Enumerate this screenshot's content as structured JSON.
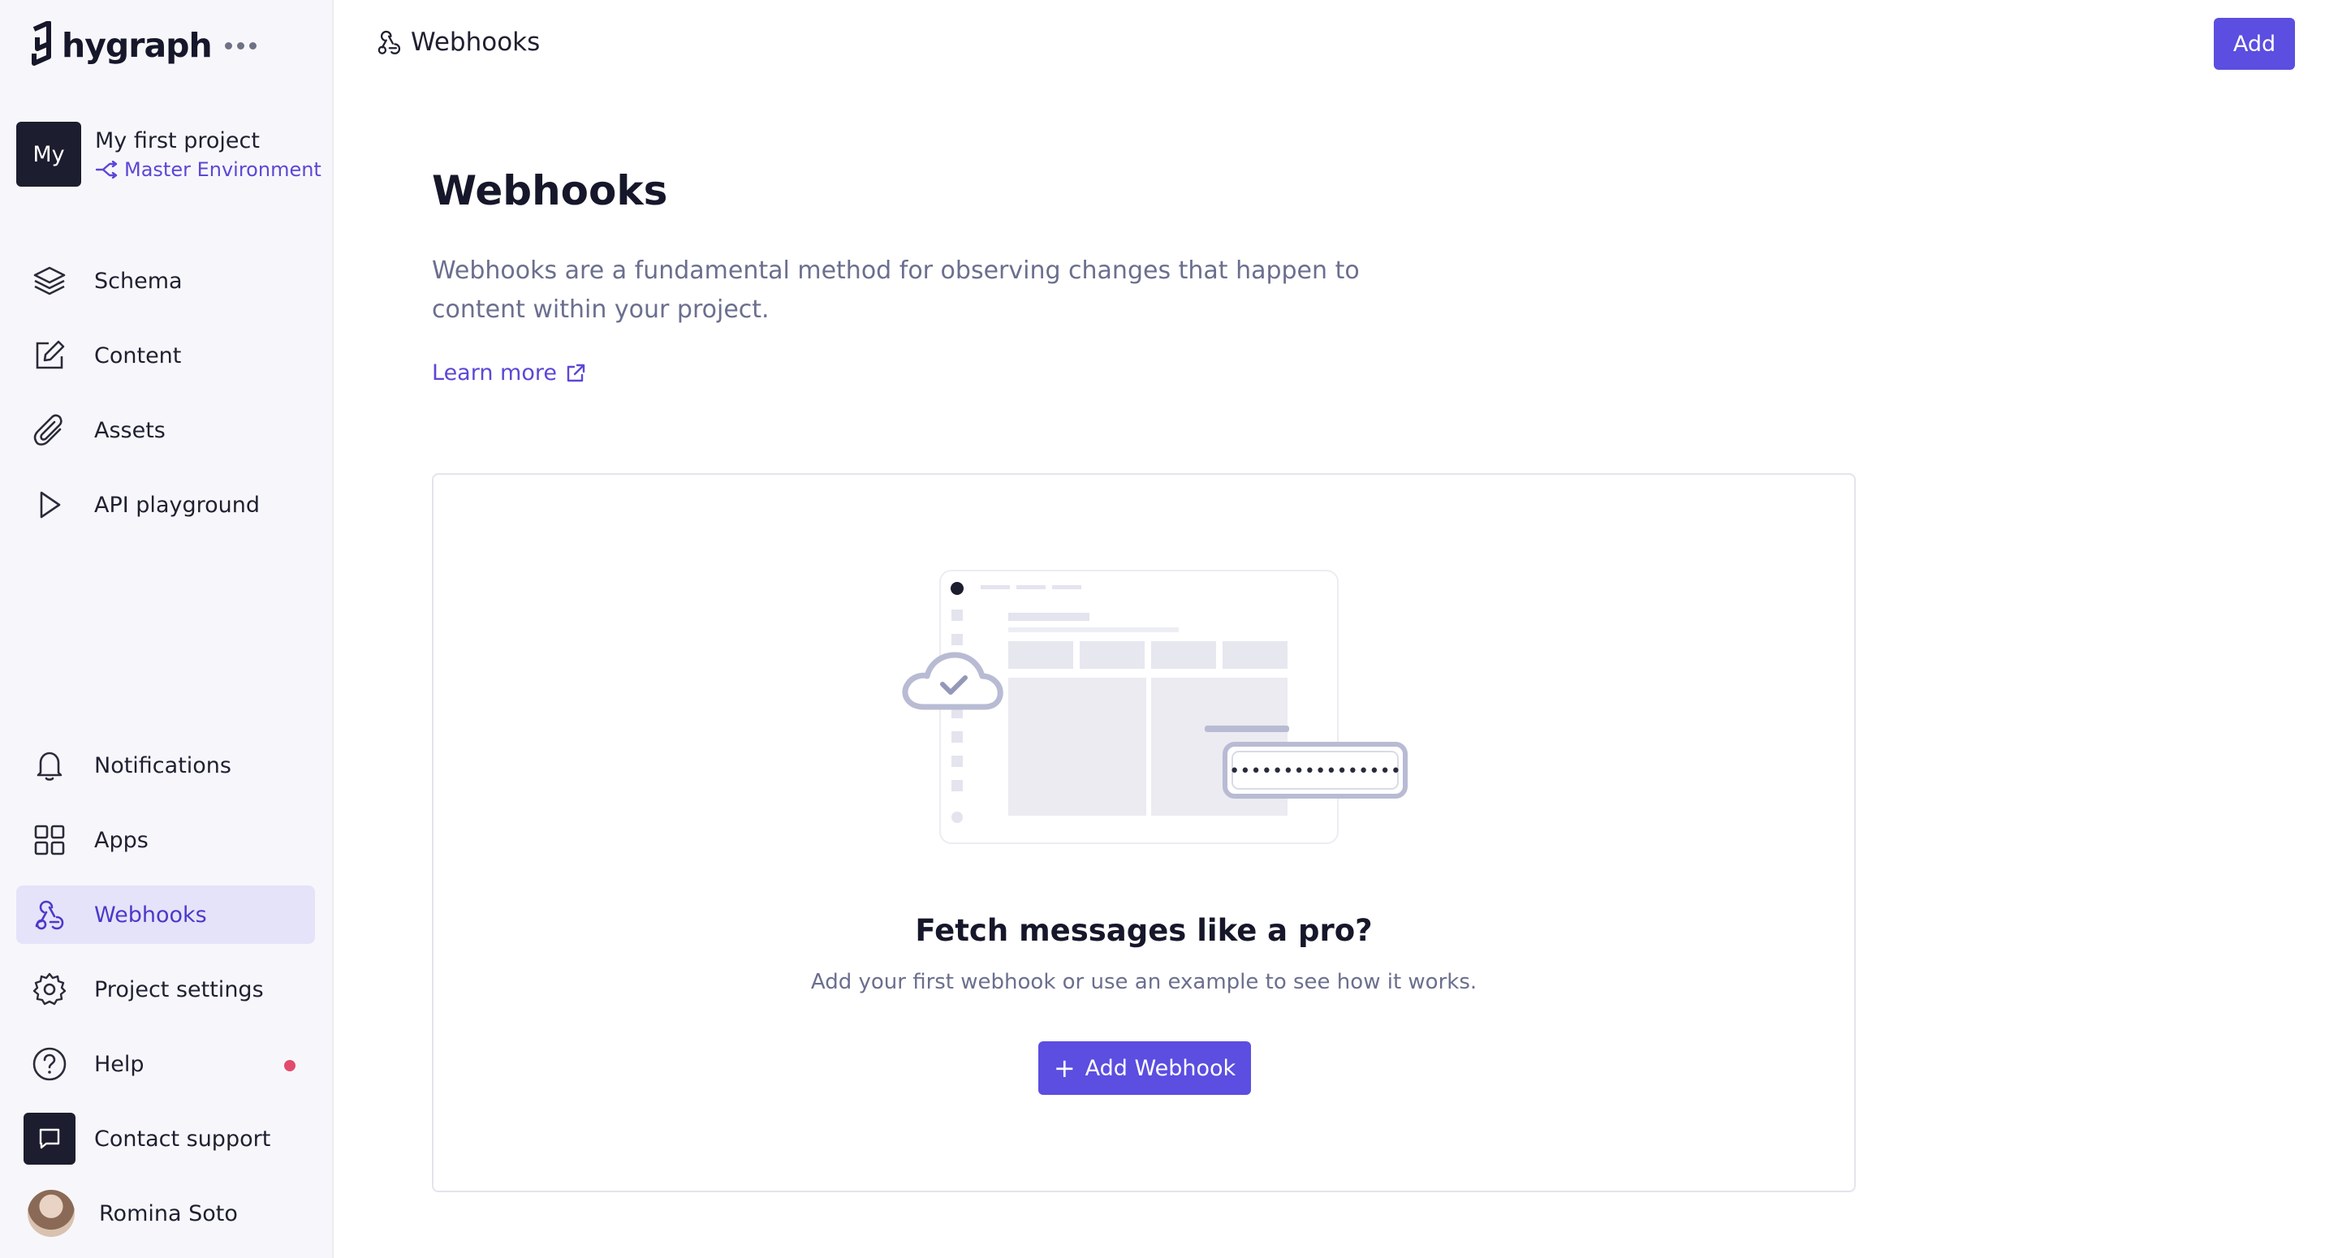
{
  "brand": {
    "name": "hygraph"
  },
  "project": {
    "avatar_text": "My",
    "name": "My first project",
    "environment": "Master Environment"
  },
  "nav": {
    "schema": "Schema",
    "content": "Content",
    "assets": "Assets",
    "api_playground": "API playground",
    "notifications": "Notifications",
    "apps": "Apps",
    "webhooks": "Webhooks",
    "project_settings": "Project settings",
    "help": "Help",
    "contact_support": "Contact support",
    "user_name": "Romina Soto"
  },
  "header": {
    "title": "Webhooks",
    "add_label": "Add"
  },
  "main": {
    "title": "Webhooks",
    "description": "Webhooks are a fundamental method for observing changes that happen to content within your project.",
    "learn_more": "Learn more"
  },
  "empty_state": {
    "title": "Fetch messages like a pro?",
    "subtitle": "Add your first webhook or use an example to see how it works.",
    "button_label": "Add Webhook",
    "secret_mask": "••••••••••••••••"
  },
  "colors": {
    "accent": "#5b4ee0",
    "active_bg": "#e5e3f9",
    "active_text": "#4b39c9",
    "sidebar_bg": "#f7f7fb",
    "help_dot": "#e24b6e"
  },
  "icons": {
    "brand": "hygraph-logo-icon",
    "schema": "layers-icon",
    "content": "edit-icon",
    "assets": "paperclip-icon",
    "api_playground": "play-icon",
    "notifications": "bell-icon",
    "apps": "grid-icon",
    "webhooks": "webhook-icon",
    "project_settings": "gear-icon",
    "help": "help-circle-icon",
    "contact_support": "chat-icon",
    "learn_more": "external-link-icon"
  }
}
